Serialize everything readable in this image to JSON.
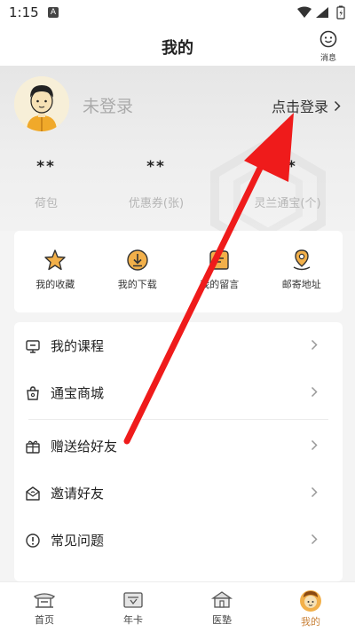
{
  "status_bar": {
    "time": "1:15",
    "notification": "A"
  },
  "header": {
    "title": "我的",
    "message_label": "消息"
  },
  "profile": {
    "login_status": "未登录",
    "login_link": "点击登录",
    "stats": [
      {
        "value": "**",
        "label": "荷包"
      },
      {
        "value": "**",
        "label": "优惠券(张)"
      },
      {
        "value": "**",
        "label": "灵兰通宝(个)"
      }
    ]
  },
  "shortcuts": [
    {
      "label": "我的收藏",
      "icon": "star-icon"
    },
    {
      "label": "我的下载",
      "icon": "download-icon"
    },
    {
      "label": "我的留言",
      "icon": "message-icon"
    },
    {
      "label": "邮寄地址",
      "icon": "location-pin-icon"
    }
  ],
  "menu": [
    {
      "label": "我的课程",
      "icon": "course-icon"
    },
    {
      "label": "通宝商城",
      "icon": "shop-bag-icon"
    },
    {
      "label": "赠送给好友",
      "icon": "gift-icon"
    },
    {
      "label": "邀请好友",
      "icon": "invite-envelope-icon"
    },
    {
      "label": "常见问题",
      "icon": "faq-icon"
    }
  ],
  "tabs": [
    {
      "label": "首页",
      "active": false
    },
    {
      "label": "年卡",
      "active": false
    },
    {
      "label": "医塾",
      "active": false
    },
    {
      "label": "我的",
      "active": true
    }
  ],
  "colors": {
    "accent": "#c9823a",
    "arrow": "#ef1b1b",
    "avatar_skin": "#f6e1b5"
  }
}
